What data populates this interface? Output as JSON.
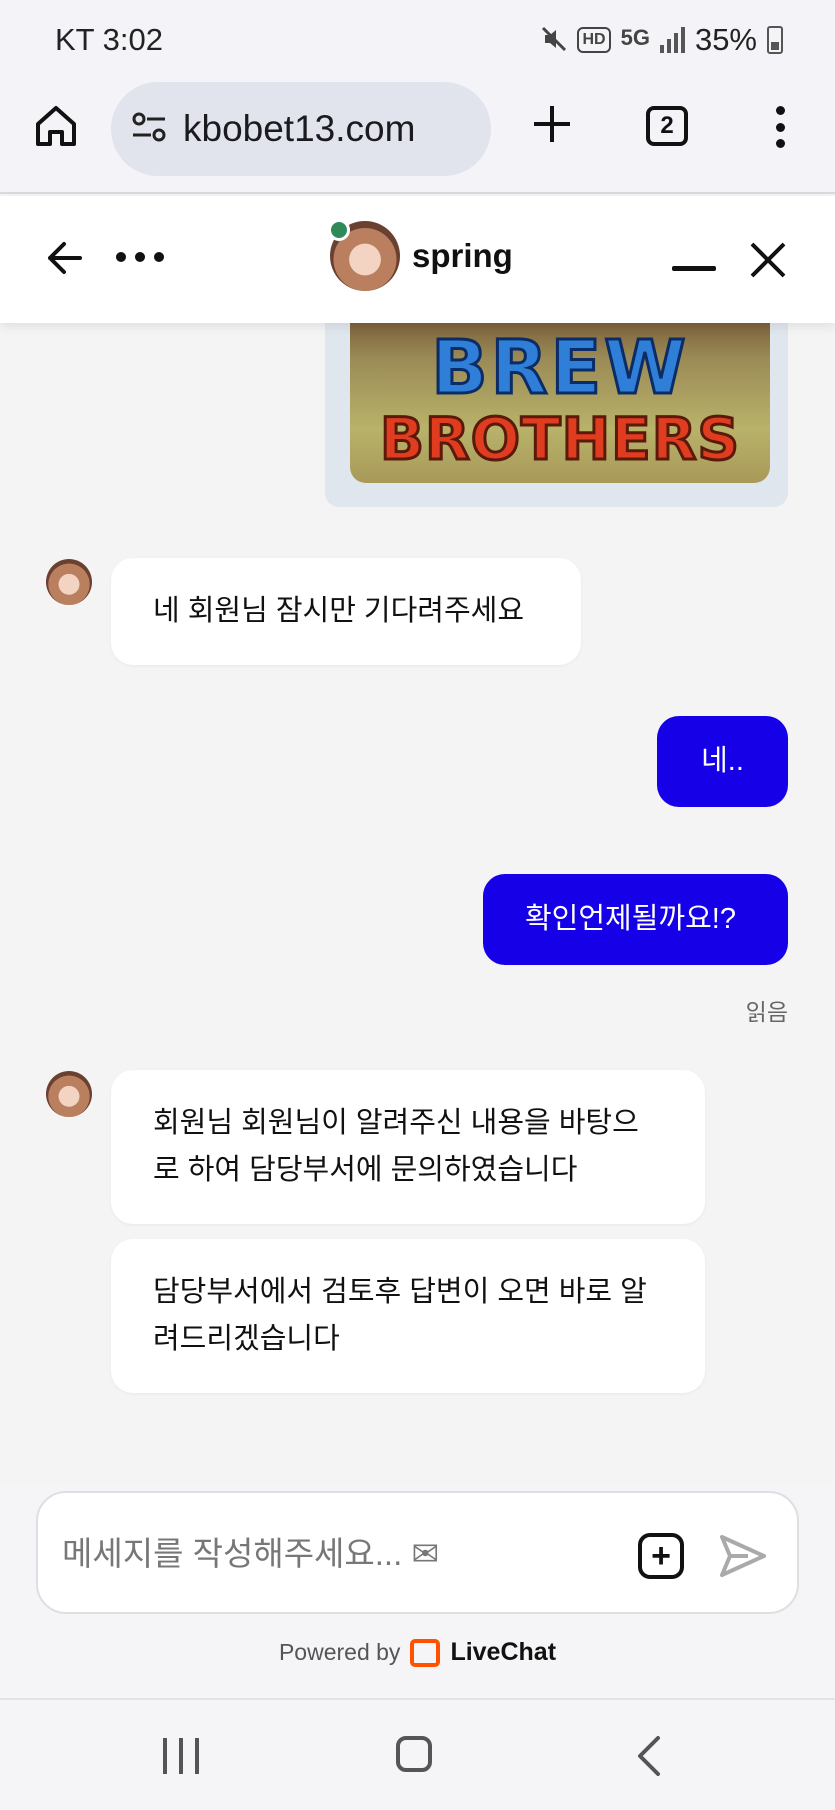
{
  "status_bar": {
    "carrier_time": "KT 3:02",
    "hd_label": "HD",
    "network_label": "5G",
    "battery": "35%"
  },
  "browser": {
    "url": "kbobet13.com",
    "tab_count": "2"
  },
  "chat_header": {
    "agent_name": "spring",
    "agent_online": true
  },
  "shared_image": {
    "line1": "BREW",
    "line2": "BROTHERS"
  },
  "messages": [
    {
      "from": "agent",
      "text": "네 회원님 잠시만 기다려주세요"
    },
    {
      "from": "user",
      "text": "네.."
    },
    {
      "from": "user",
      "text": "확인언제될까요!?"
    },
    {
      "from": "agent",
      "text": "회원님 회원님이 알려주신 내용을 바탕으로 하여 담당부서에 문의하였습니다"
    },
    {
      "from": "agent",
      "text": "담당부서에서 검토후 답변이 오면 바로 알려드리겠습니다"
    }
  ],
  "read_receipt": "읽음",
  "composer": {
    "placeholder": "메세지를 작성해주세요... ✉"
  },
  "footer": {
    "powered_by": "Powered by",
    "brand": "LiveChat"
  },
  "colors": {
    "user_bubble": "#1600e8",
    "online": "#2e8b57",
    "livechat": "#ff5100"
  }
}
